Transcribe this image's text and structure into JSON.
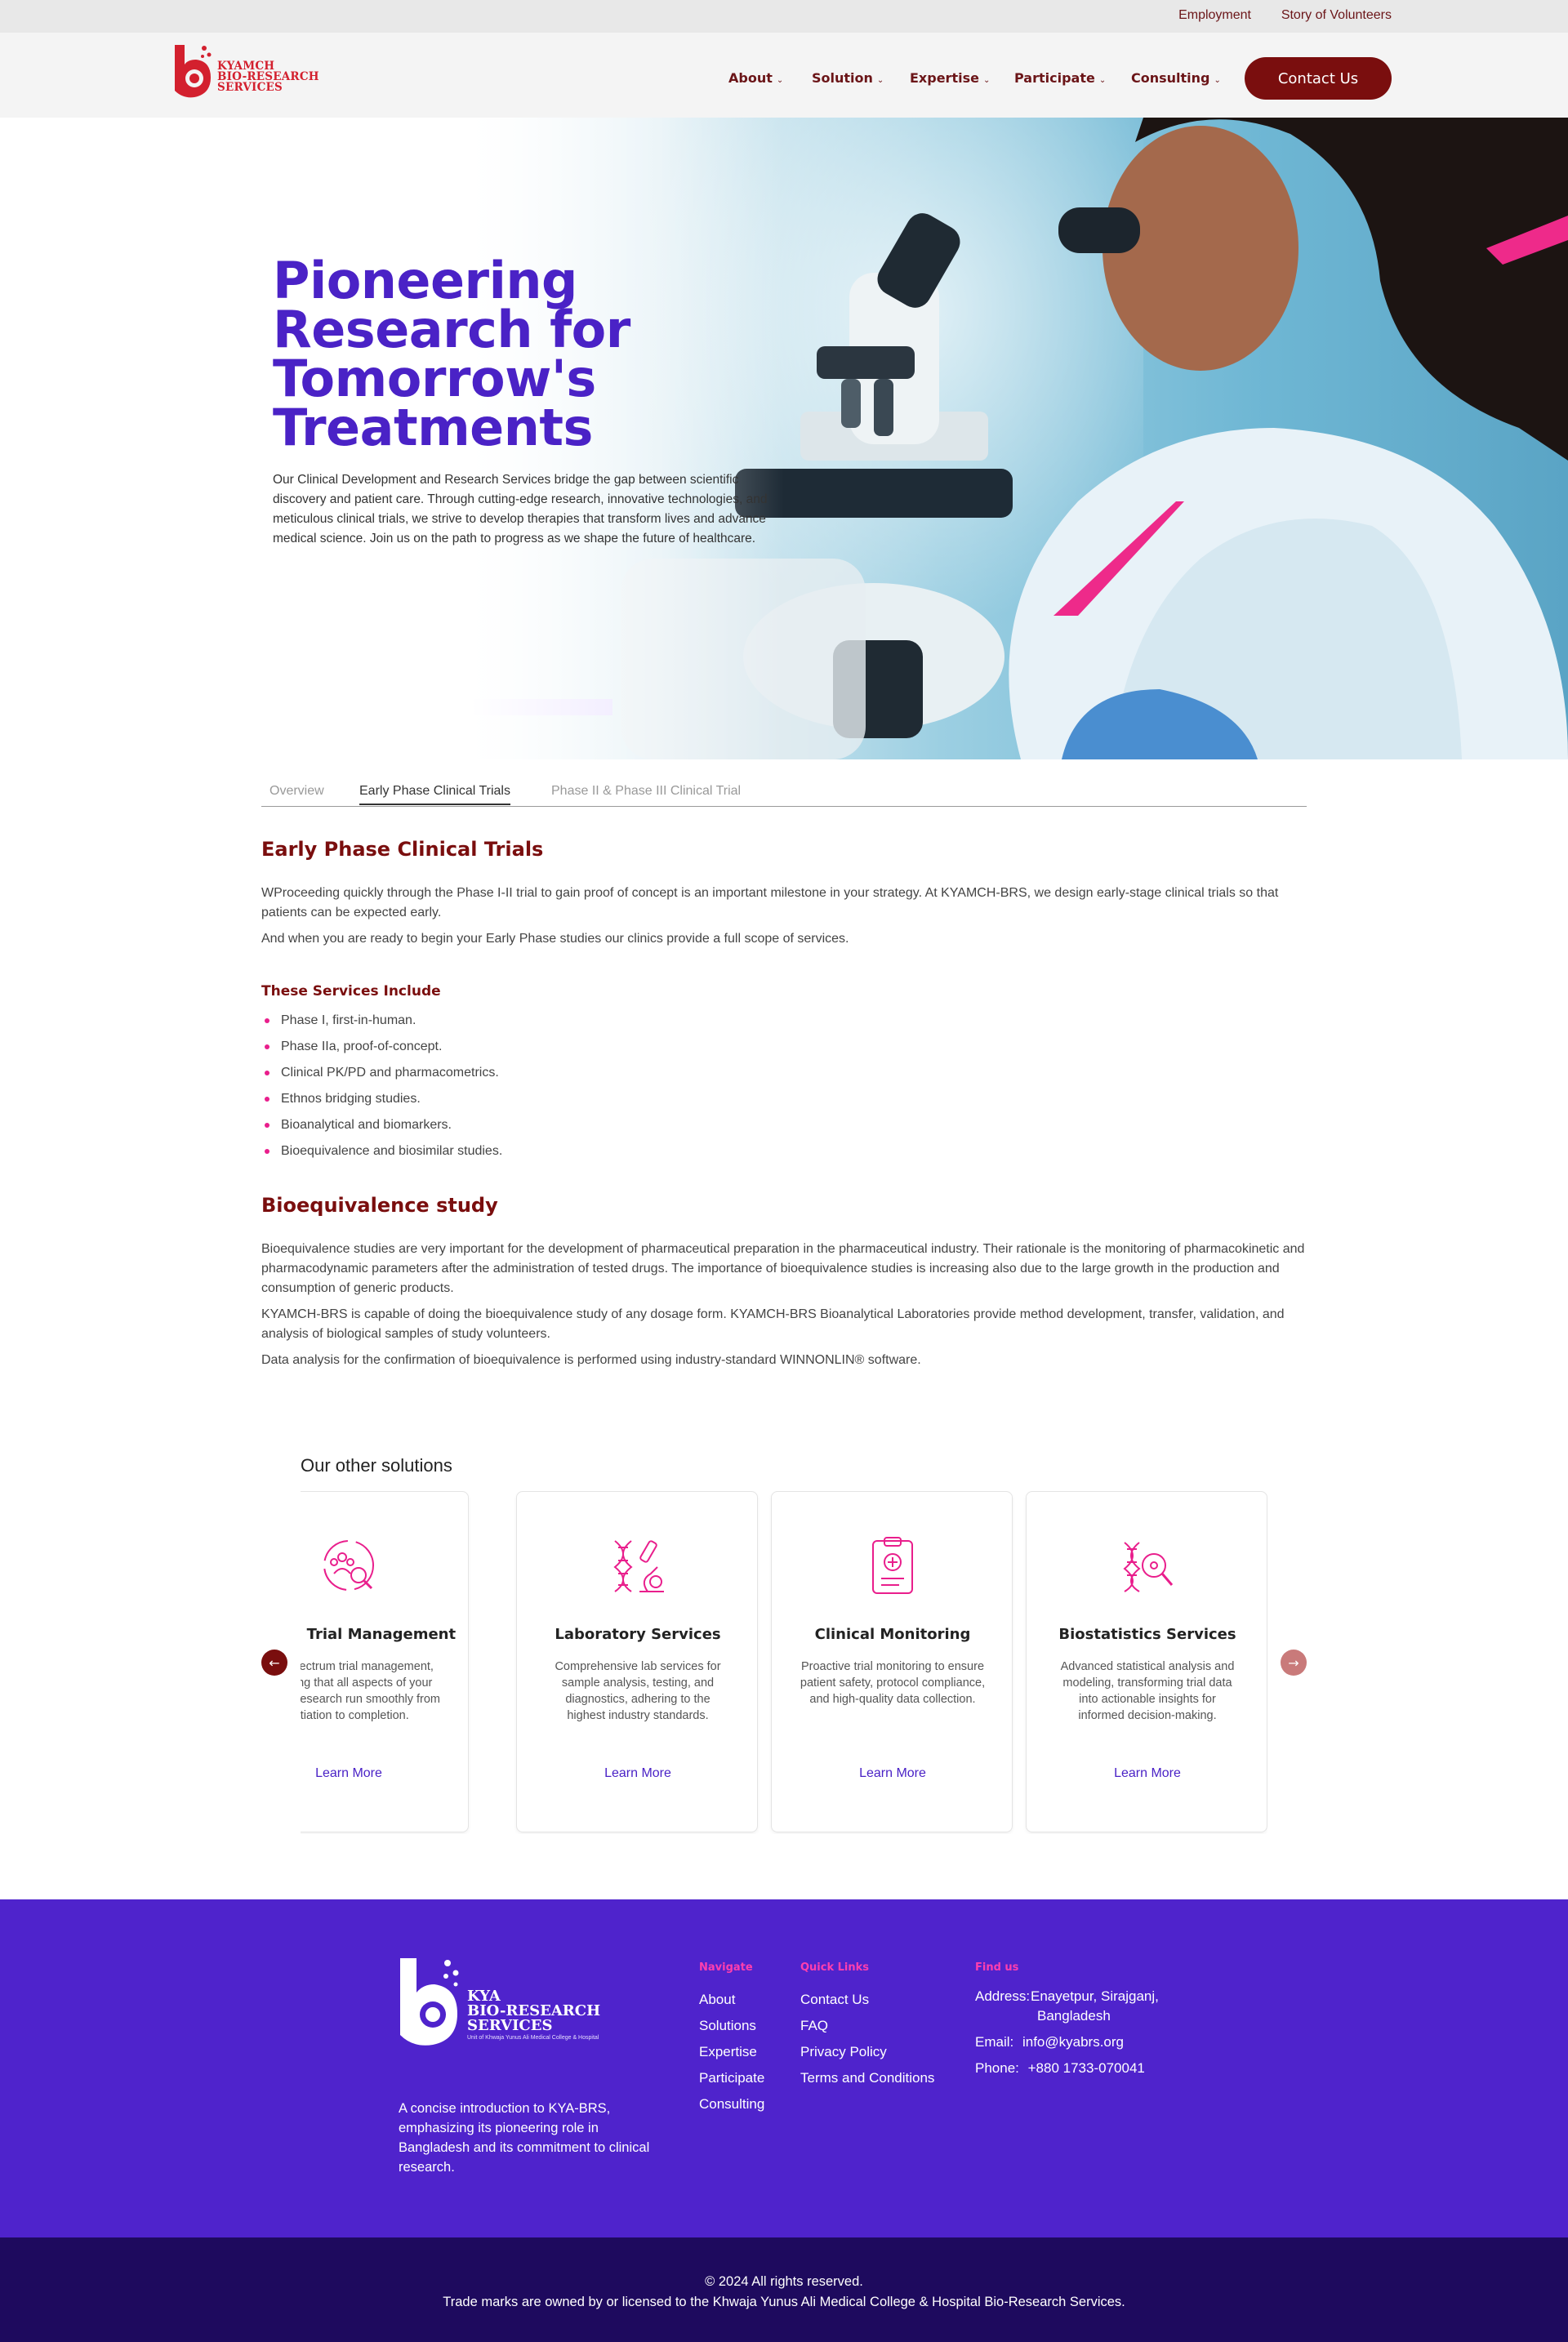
{
  "topbar": {
    "employment": "Employment",
    "story": "Story of Volunteers"
  },
  "header": {
    "logo_text": [
      "KYAMCH",
      "BIO-RESEARCH",
      "SERVICES"
    ],
    "nav": [
      {
        "label": "About"
      },
      {
        "label": "Solution"
      },
      {
        "label": "Expertise"
      },
      {
        "label": "Participate"
      },
      {
        "label": "Consulting"
      }
    ],
    "contact_label": "Contact Us"
  },
  "hero": {
    "title_lines": [
      "Pioneering",
      "Research for",
      "Tomorrow's",
      "Treatments"
    ],
    "description": "Our Clinical Development and Research Services bridge the gap between scientific discovery and patient care. Through cutting-edge research, innovative technologies, and meticulous clinical trials, we strive to develop therapies that transform lives and advance medical science. Join us on the path to progress as we shape the future of healthcare."
  },
  "tabs": [
    {
      "label": "Overview",
      "active": false
    },
    {
      "label": "Early Phase Clinical Trials",
      "active": true
    },
    {
      "label": "Phase II & Phase III Clinical Trial",
      "active": false
    }
  ],
  "early_phase": {
    "heading": "Early Phase Clinical Trials",
    "para1": "WProceeding quickly through the Phase I-II trial to gain proof of concept is an important milestone in your strategy. At KYAMCH-BRS, we design early-stage clinical trials so that patients can be expected early.",
    "para2": "And when you are ready to begin your Early Phase studies our clinics provide a full scope of services.",
    "services_heading": "These Services Include",
    "services": [
      "Phase I, first-in-human.",
      "Phase IIa, proof-of-concept.",
      "Clinical PK/PD and pharmacometrics.",
      "Ethnos bridging studies.",
      "Bioanalytical and biomarkers.",
      "Bioequivalence and biosimilar studies."
    ]
  },
  "bioequivalence": {
    "heading": "Bioequivalence study",
    "para1": "Bioequivalence studies are very important for the development of pharmaceutical preparation in the pharmaceutical industry. Their rationale is the monitoring of pharmacokinetic and pharmacodynamic parameters after the administration of tested drugs. The importance of bioequivalence studies is increasing also due to the large growth in the production and consumption of generic products.",
    "para2": "KYAMCH-BRS is capable of doing the bioequivalence study of any dosage form. KYAMCH-BRS Bioanalytical Laboratories provide method development, transfer, validation, and analysis of biological samples of study volunteers.",
    "para3": "Data analysis for the confirmation of bioequivalence is performed using industry-standard WINNONLIN® software."
  },
  "solutions": {
    "title": "Our other solutions",
    "cards": [
      {
        "icon": "trial-management-icon",
        "title": "Clinical Trial Management",
        "desc": "Full-spectrum trial management, ensuring that all aspects of your clinical research run smoothly from initiation to completion.",
        "link": "Learn More"
      },
      {
        "icon": "laboratory-icon",
        "title": "Laboratory Services",
        "desc": "Comprehensive lab services for sample analysis, testing, and diagnostics, adhering to the highest industry standards.",
        "link": "Learn More"
      },
      {
        "icon": "clipboard-icon",
        "title": "Clinical Monitoring",
        "desc": "Proactive trial monitoring to ensure patient safety, protocol compliance, and high-quality data collection.",
        "link": "Learn More"
      },
      {
        "icon": "dna-search-icon",
        "title": "Biostatistics Services",
        "desc": "Advanced statistical analysis and modeling, transforming trial data into actionable insights for informed decision-making.",
        "link": "Learn More"
      }
    ],
    "prev": "←",
    "next": "→"
  },
  "footer": {
    "logo_text": [
      "KYA",
      "BIO-RESEARCH",
      "SERVICES"
    ],
    "logo_sub": "Unit of Khwaja Yunus Ali Medical College & Hospital",
    "about": "A concise introduction to KYA-BRS, emphasizing its pioneering role in Bangladesh and its commitment to clinical research.",
    "navigate_heading": "Navigate",
    "navigate": [
      "About",
      "Solutions",
      "Expertise",
      "Participate",
      "Consulting"
    ],
    "quick_heading": "Quick Links",
    "quick": [
      "Contact Us",
      "FAQ",
      "Privacy Policy",
      "Terms and Conditions"
    ],
    "find_heading": "Find us",
    "address_label": "Address:",
    "address_line1": "Enayetpur, Sirajganj,",
    "address_line2": "Bangladesh",
    "email_label": "Email:",
    "email": "info@kyabrs.org",
    "phone_label": "Phone:",
    "phone": "+880 1733-070041",
    "copyright": "© 2024 All rights reserved.",
    "trademark": "Trade marks are owned by or licensed to the Khwaja Yunus Ali Medical College & Hospital Bio-Research Services."
  },
  "colors": {
    "brand_maroon": "#7a0e0e",
    "brand_purple": "#4f23cc",
    "accent_pink": "#e91e8c",
    "footer_dark": "#1e0a5e"
  }
}
